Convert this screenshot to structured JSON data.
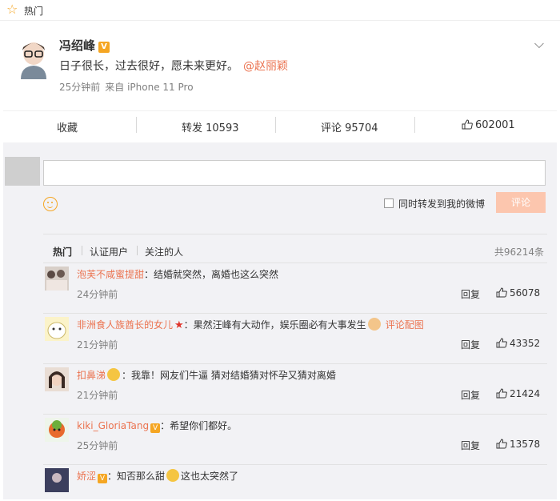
{
  "topbar": {
    "title": "热门"
  },
  "post": {
    "author": "冯绍峰",
    "content": "日子很长，过去很好，愿未来更好。",
    "mention": "@赵丽颖",
    "time": "25分钟前",
    "source": "来自 iPhone 11 Pro"
  },
  "actions": {
    "favorite": "收藏",
    "repost": "转发 10593",
    "comment": "评论 95704",
    "like": "602001"
  },
  "composer": {
    "input_value": "",
    "forward_label": "同时转发到我的微博",
    "submit_label": "评论"
  },
  "filters": {
    "tabs": [
      "热门",
      "认证用户",
      "关注的人"
    ],
    "total": "共96214条"
  },
  "comments": [
    {
      "name": "泡芙不咸蜜提甜",
      "text": "：结婚就突然，离婚也这么突然",
      "time": "24分钟前",
      "reply": "回复",
      "likes": "56078"
    },
    {
      "name": "非洲食人族酋长的女儿",
      "text": "：果然汪峰有大动作，娱乐圈必有大事发生",
      "link": "评论配图",
      "time": "21分钟前",
      "reply": "回复",
      "likes": "43352"
    },
    {
      "name": "扣鼻涕",
      "text": "：我靠！网友们牛逼 猜对结婚猜对怀孕又猜对离婚",
      "time": "21分钟前",
      "reply": "回复",
      "likes": "21424"
    },
    {
      "name": "kiki_GloriaTang",
      "text": "：希望你们都好。",
      "time": "25分钟前",
      "reply": "回复",
      "likes": "13578"
    },
    {
      "name": "娇涩",
      "text": "：知否那么甜",
      "text2": "这也太突然了",
      "time": "",
      "reply": "",
      "likes": ""
    }
  ],
  "colors": {
    "accent": "#eb7350",
    "vip": "#f5a623",
    "submit_disabled": "#fcc6ae"
  },
  "icons": [
    "star-icon",
    "chevron-down-icon",
    "thumb-up-icon",
    "smiley-icon",
    "v-badge-icon",
    "red-star-icon"
  ]
}
